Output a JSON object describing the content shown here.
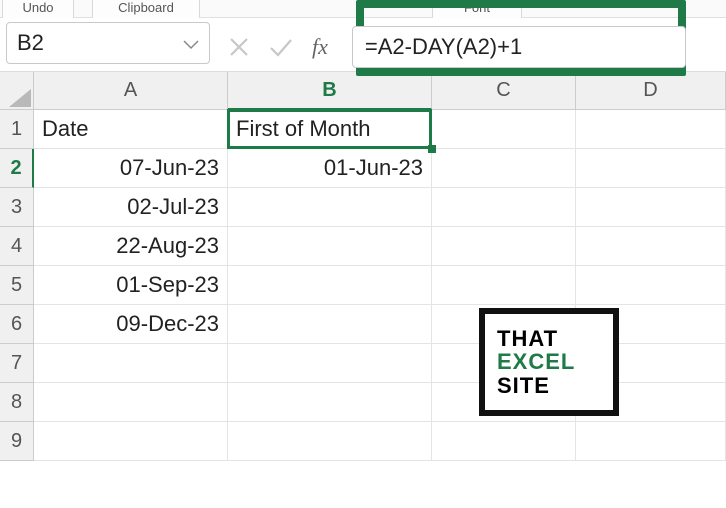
{
  "ribbon": {
    "undo_label": "Undo",
    "clipboard_label": "Clipboard",
    "font_label": "Font"
  },
  "formula_bar": {
    "cell_ref": "B2",
    "formula": "=A2-DAY(A2)+1"
  },
  "columns": {
    "A": "A",
    "B": "B",
    "C": "C",
    "D": "D"
  },
  "rows": {
    "1": "1",
    "2": "2",
    "3": "3",
    "4": "4",
    "5": "5",
    "6": "6",
    "7": "7",
    "8": "8",
    "9": "9"
  },
  "cells": {
    "A1": "Date",
    "B1": "First of Month",
    "A2": "07-Jun-23",
    "B2": "01-Jun-23",
    "A3": "02-Jul-23",
    "A4": "22-Aug-23",
    "A5": "01-Sep-23",
    "A6": "09-Dec-23"
  },
  "watermark": {
    "line1": "THAT",
    "line2": "EXCEL",
    "line3": "SITE"
  },
  "selection": {
    "cell": "B2"
  }
}
